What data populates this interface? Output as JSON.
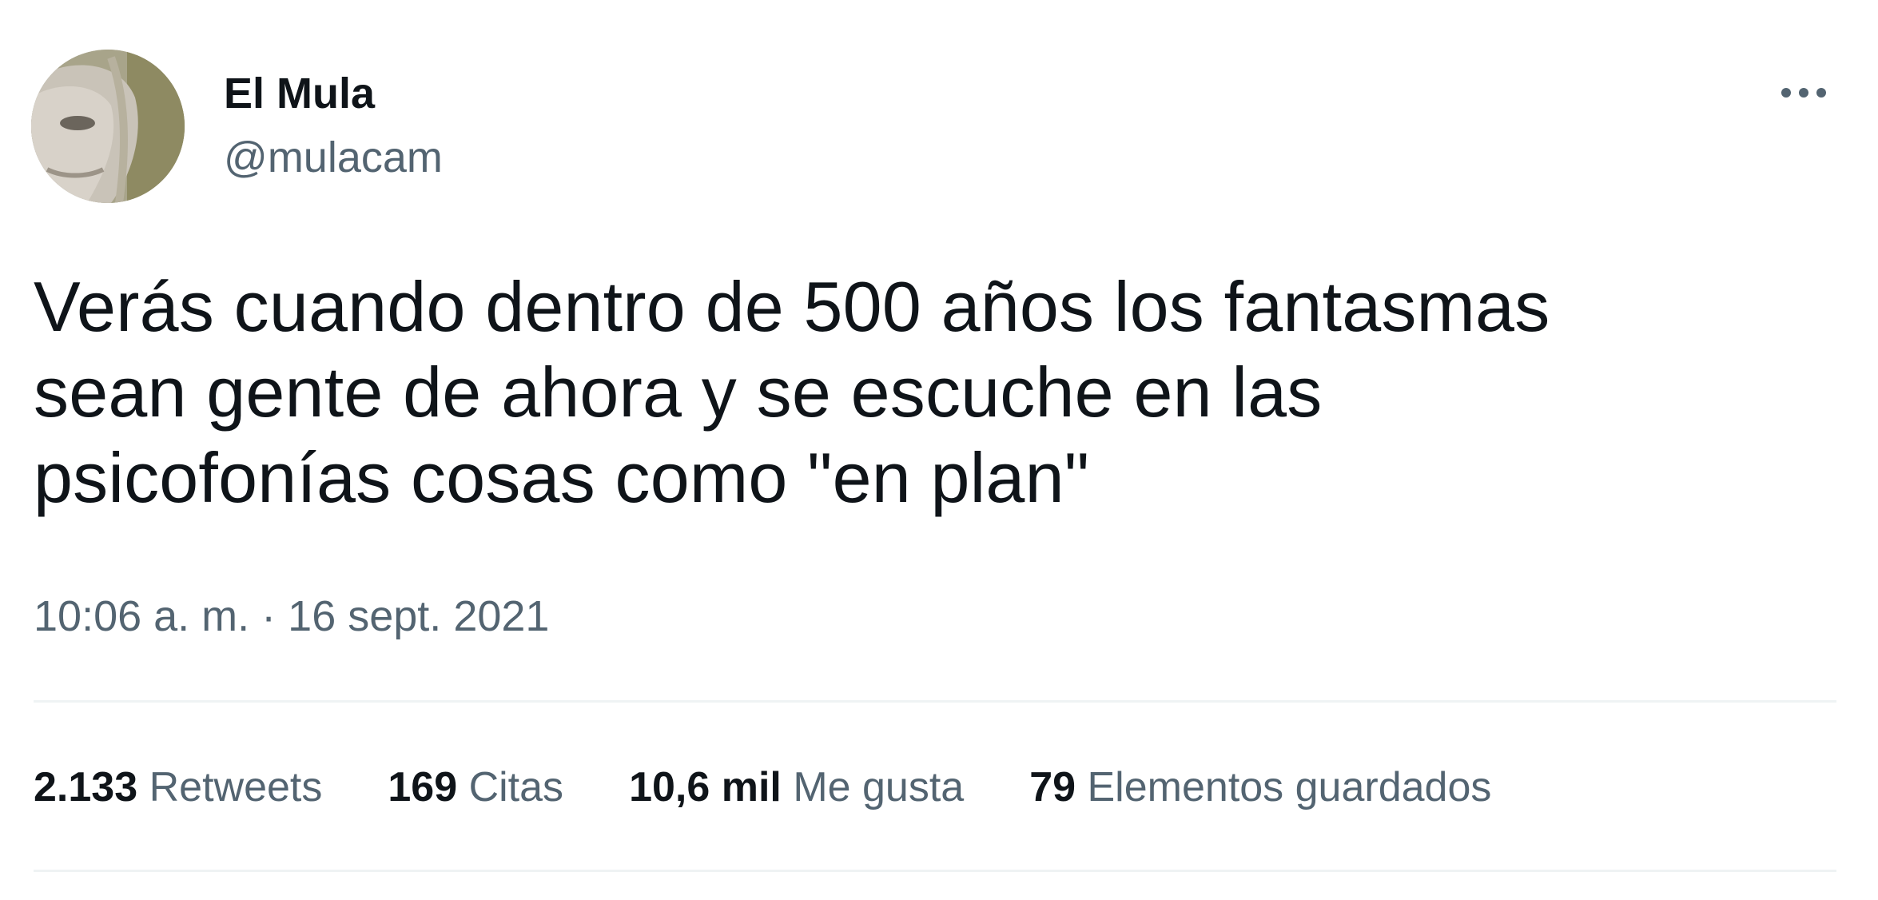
{
  "author": {
    "display_name": "El Mula",
    "handle": "@mulacam"
  },
  "tweet": {
    "text": "Verás cuando dentro de 500 años los fantasmas\nsean gente de ahora y se escuche en las\npsicofonías cosas como \"en plan\"",
    "time": "10:06 a. m.",
    "separator": " · ",
    "date": "16 sept. 2021"
  },
  "stats": [
    {
      "count": "2.133",
      "label": "Retweets"
    },
    {
      "count": "169",
      "label": "Citas"
    },
    {
      "count": "10,6 mil",
      "label": "Me gusta"
    },
    {
      "count": "79",
      "label": "Elementos guardados"
    }
  ],
  "icons": {
    "more": "more-horizontal-icon",
    "avatar": "avatar-photo"
  },
  "colors": {
    "text_primary": "#0f1419",
    "text_secondary": "#536471",
    "divider": "#eff3f4",
    "background": "#ffffff"
  }
}
